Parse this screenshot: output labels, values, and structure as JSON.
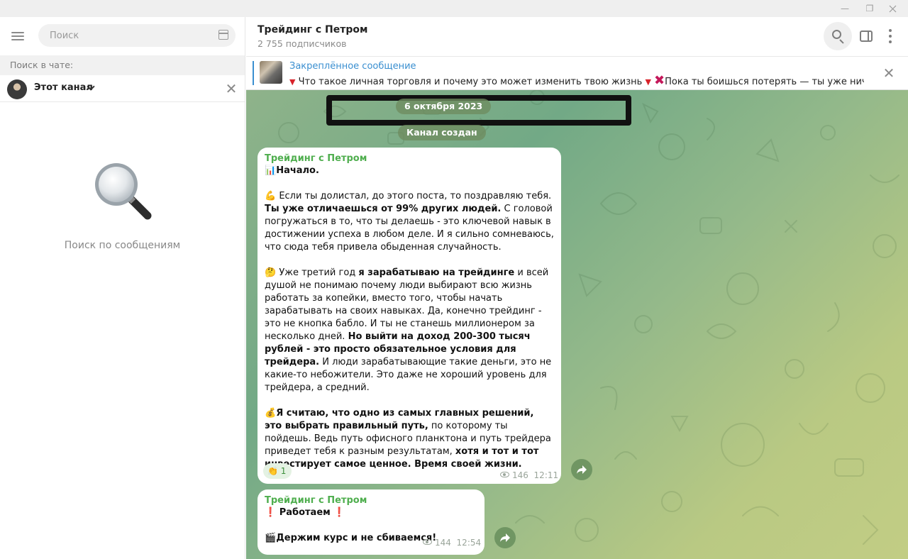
{
  "window": {
    "minimize_glyph": "—",
    "restore_glyph": "❐"
  },
  "left_panel": {
    "search_placeholder": "Поиск",
    "search_in_chat_label": "Поиск в чате:",
    "scope_label": "Этот канал",
    "close_glyph": "✕",
    "empty_text": "Поиск по сообщениям"
  },
  "chat_header": {
    "title": "Трейдинг с Петром",
    "subscribers": "2 755 подписчиков",
    "icons": [
      "search-icon",
      "side-panel-icon",
      "more-icon"
    ]
  },
  "pinned": {
    "title": "Закреплённое сообщение",
    "text_part1": "Что такое личная торговля и почему это может изменить твою жизнь",
    "text_part2": "Пока ты боишься потерять — ты уже ничего н...",
    "tri_glyph": "▼",
    "x_glyph": "✖",
    "close_glyph": "✕"
  },
  "service": {
    "date": "6 октября 2023",
    "created": "Канал создан"
  },
  "messages": [
    {
      "author": "Трейдинг с Петром",
      "p1_emoji": "📊",
      "p1_text": "Начало.",
      "p2_emoji": "💪",
      "p2_a": " Если ты долистал, до этого поста, то поздравляю тебя. ",
      "p2_b": "Ты уже отличаешься от 99% других людей.",
      "p2_c": " С головой погружаться в то, что ты делаешь - это ключевой навык в достижении успеха в любом деле. И я сильно сомневаюсь, что сюда тебя привела обыденная случайность.",
      "p3_emoji": "🤔",
      "p3_a": " Уже третий год ",
      "p3_b": "я зарабатываю на трейдинге",
      "p3_c": " и всей душой не понимаю почему люди выбирают всю жизнь работать за копейки, вместо того, чтобы начать зарабатывать на своих навыках. Да, конечно трейдинг - это не кнопка бабло. И ты не станешь миллионером за несколько дней. ",
      "p3_d": "Но выйти на доход 200-300 тысяч рублей - это просто обязательное условия для трейдера.",
      "p3_e": " И люди зарабатывающие такие деньги, это не какие-то небожители. Это даже не хороший уровень для трейдера, а средний.",
      "p4_emoji": "💰",
      "p4_a": "Я считаю, что одно из самых главных решений, это выбрать правильный путь,",
      "p4_b": " по которому ты пойдешь. Ведь путь офисного планктона и путь трейдера приведет тебя к разным результатам, ",
      "p4_c": "хотя и тот и тот инвестирует самое ценное. Время своей жизни.",
      "reaction_emoji": "👏",
      "reaction_count": "1",
      "views": "146",
      "time": "12:11"
    },
    {
      "author": "Трейдинг с Петром",
      "l1_mark": "❗",
      "l1_text": " Работаем ",
      "l2_emoji": "🎬",
      "l2_text": "Держим курс и не сбиваемся!",
      "views": "144",
      "time": "12:54"
    }
  ]
}
